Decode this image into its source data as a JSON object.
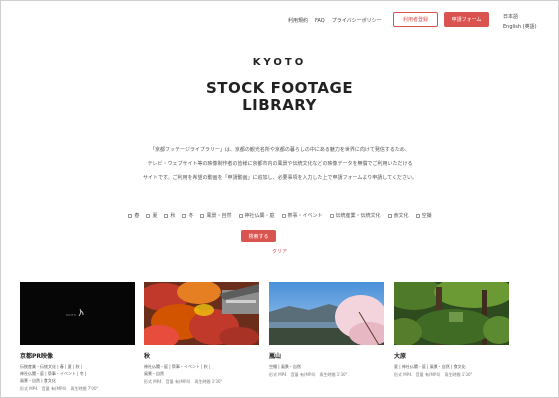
{
  "header": {
    "nav": [
      "利用規約",
      "FAQ",
      "プライバシーポリシー"
    ],
    "register_label": "利用者登録",
    "apply_label": "申請フォーム",
    "lang": [
      "日本語",
      "English (英語)"
    ]
  },
  "logo": {
    "top": "KYOTO",
    "line1": "STOCK FOOTAGE",
    "line2": "LIBRARY"
  },
  "description": {
    "line1": "「京都フッテージライブラリー」は、京都の観光名所や京都の暮らしの中にある魅力を世界に向けて発信するため、",
    "line2": "テレビ・ウェブサイト等の映像制作者の皆様に京都市内の風景や伝統文化などの映像データを無償でご利用いただける",
    "line3": "サイトです。ご利用を希望の動画を「申請動画」に追加し、必要事項を入力した上で申請フォームより申請してください。"
  },
  "categories": [
    "春",
    "夏",
    "秋",
    "冬",
    "風景・自然",
    "神社仏閣・庭",
    "祭事・イベント",
    "伝統産業・伝統文化",
    "食文化",
    "空撮"
  ],
  "search_label": "検索する",
  "clear_label": "クリア",
  "cards": [
    {
      "title": "京都PR映像",
      "tags": "伝統産業・伝統文化 | 春 | 夏 | 秋 |",
      "tags2": "神社仏閣・庭 | 祭事・イベント | 冬 |",
      "tags3": "風景・自然 | 食文化",
      "meta": "形式 MP4　音量 有(MP4)　再生時間 7'00\""
    },
    {
      "title": "秋",
      "tags": "神社仏閣・庭 | 祭事・イベント | 秋 |",
      "tags2": "風景・自然",
      "tags3": "",
      "meta": "形式 MP4　音量 有(MP4)　再生時間 1'30\""
    },
    {
      "title": "嵐山",
      "tags": "空撮 | 風景・自然",
      "tags2": "",
      "tags3": "",
      "meta": "形式 MP4　音量 有(MP4)　再生時間 1'30\""
    },
    {
      "title": "大原",
      "tags": "夏 | 神社仏閣・庭 | 風景・自然 | 食文化",
      "tags2": "",
      "tags3": "",
      "meta": "形式 MP4　音量 有(MP4)　再生時間 1'30\""
    }
  ]
}
